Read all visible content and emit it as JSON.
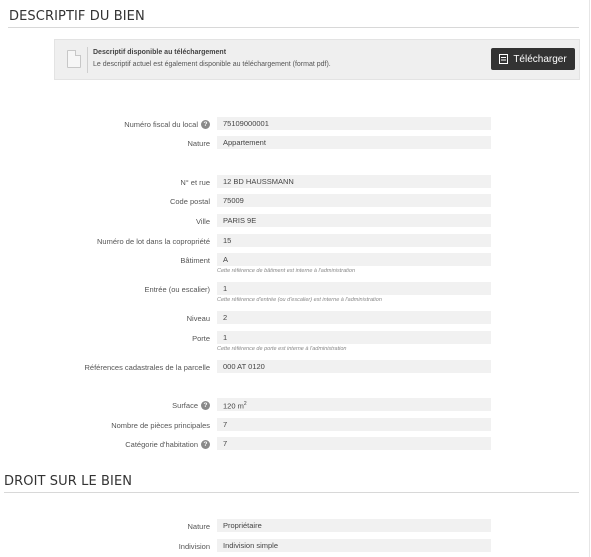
{
  "descriptif": {
    "title": "DESCRIPTIF DU BIEN",
    "download_panel": {
      "title": "Descriptif disponible au téléchargement",
      "description": "Le descriptif actuel est également disponible au téléchargement (format pdf).",
      "button_label": "Télécharger"
    },
    "fields": [
      {
        "label": "Numéro fiscal du local",
        "value": "75109000001",
        "help": true
      },
      {
        "label": "Nature",
        "value": "Appartement"
      },
      {
        "label": "N° et rue",
        "value": "12 BD HAUSSMANN"
      },
      {
        "label": "Code postal",
        "value": "75009"
      },
      {
        "label": "Ville",
        "value": "PARIS 9E"
      },
      {
        "label": "Numéro de lot dans la copropriété",
        "value": "15"
      },
      {
        "label": "Bâtiment",
        "value": "A",
        "note": "Cette référence de bâtiment est interne à l'administration"
      },
      {
        "label": "Entrée (ou escalier)",
        "value": "1",
        "note": "Cette référence d'entrée (ou d'escalier) est interne à l'administration"
      },
      {
        "label": "Niveau",
        "value": "2"
      },
      {
        "label": "Porte",
        "value": "1",
        "note": "Cette référence de porte est interne à l'administration"
      },
      {
        "label": "Références cadastrales de la parcelle",
        "value": "000 AT 0120"
      },
      {
        "label": "Surface",
        "value": "120 m",
        "unit_sup": "2",
        "help": true
      },
      {
        "label": "Nombre de pièces principales",
        "value": "7"
      },
      {
        "label": "Catégorie d'habitation",
        "value": "7",
        "help": true
      }
    ]
  },
  "droit": {
    "title": "DROIT SUR LE BIEN",
    "fields": [
      {
        "label": "Nature",
        "value": "Propriétaire"
      },
      {
        "label": "Indivision",
        "value": "Indivision simple"
      }
    ]
  },
  "help_glyph": "?"
}
